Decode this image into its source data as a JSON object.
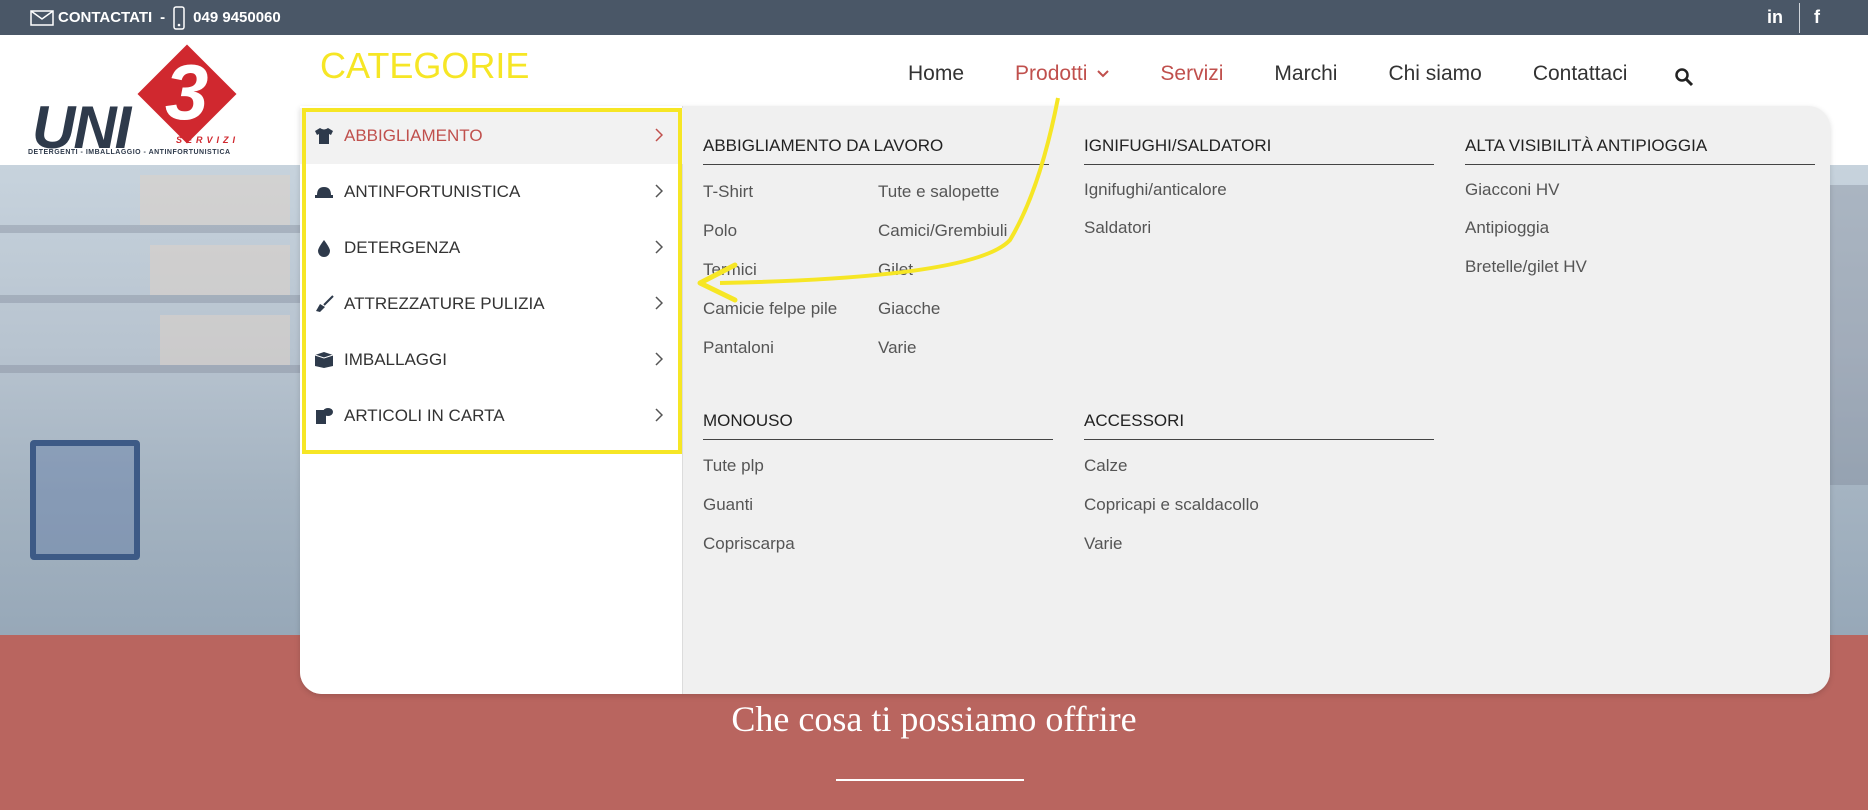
{
  "topbar": {
    "contact_label": "CONTACTATI",
    "separator": "-",
    "phone": "049 9450060",
    "linkedin": "in",
    "facebook": "f"
  },
  "logo": {
    "main": "UNI",
    "number": "3",
    "servizi": "SERVIZI",
    "tagline": "DETERGENTI - IMBALLAGGIO - ANTINFORTUNISTICA"
  },
  "annotation": {
    "categorie": "CATEGORIE"
  },
  "nav": {
    "items": [
      {
        "label": "Home"
      },
      {
        "label": "Prodotti"
      },
      {
        "label": "Servizi"
      },
      {
        "label": "Marchi"
      },
      {
        "label": "Chi siamo"
      },
      {
        "label": "Contattaci"
      }
    ]
  },
  "menu": {
    "categories": [
      {
        "label": "ABBIGLIAMENTO",
        "icon": "tshirt-icon"
      },
      {
        "label": "ANTINFORTUNISTICA",
        "icon": "hardhat-icon"
      },
      {
        "label": "DETERGENZA",
        "icon": "drop-icon"
      },
      {
        "label": "ATTREZZATURE PULIZIA",
        "icon": "broom-icon"
      },
      {
        "label": "IMBALLAGGI",
        "icon": "box-icon"
      },
      {
        "label": "ARTICOLI IN CARTA",
        "icon": "paper-roll-icon"
      }
    ],
    "groups": {
      "abbigliamento_lavoro": {
        "title": "ABBIGLIAMENTO DA LAVORO",
        "col1": [
          "T-Shirt",
          "Polo",
          "Termici",
          "Camicie felpe pile",
          "Pantaloni"
        ],
        "col2": [
          "Tute e salopette",
          "Camici/Grembiuli",
          "Gilet",
          "Giacche",
          "Varie"
        ]
      },
      "ignifughi": {
        "title": "IGNIFUGHI/SALDATORI",
        "links": [
          "Ignifughi/anticalore",
          "Saldatori"
        ]
      },
      "alta_visibilita": {
        "title": "ALTA VISIBILITÀ ANTIPIOGGIA",
        "links": [
          "Giacconi HV",
          "Antipioggia",
          "Bretelle/gilet HV"
        ]
      },
      "monouso": {
        "title": "MONOUSO",
        "links": [
          "Tute plp",
          "Guanti",
          "Copriscarpa"
        ]
      },
      "accessori": {
        "title": "ACCESSORI",
        "links": [
          "Calze",
          "Copricapi e scaldacollo",
          "Varie"
        ]
      }
    }
  },
  "band": {
    "title": "Che cosa ti possiamo offrire"
  },
  "colors": {
    "topbar": "#4a5767",
    "accent_red": "#c0504d",
    "band": "#b9655f",
    "annotation_yellow": "#f6e625"
  }
}
